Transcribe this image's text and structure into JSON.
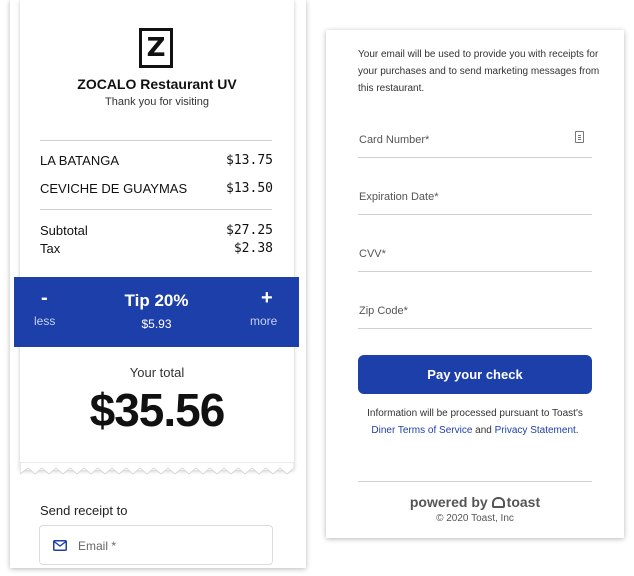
{
  "receipt": {
    "logo_letter": "Z",
    "restaurant_name": "ZOCALO Restaurant UV",
    "subtitle": "Thank you for visiting",
    "items": [
      {
        "name": "LA BATANGA",
        "price": "$13.75"
      },
      {
        "name": "CEVICHE DE GUAYMAS",
        "price": "$13.50"
      }
    ],
    "subtotal_label": "Subtotal",
    "subtotal_value": "$27.25",
    "tax_label": "Tax",
    "tax_value": "$2.38"
  },
  "tip": {
    "minus_symbol": "-",
    "less_label": "less",
    "title": "Tip 20%",
    "amount": "$5.93",
    "plus_symbol": "+",
    "more_label": "more"
  },
  "total": {
    "label": "Your total",
    "amount": "$35.56"
  },
  "send_receipt": {
    "label": "Send receipt to",
    "email_placeholder": "Email *"
  },
  "payment": {
    "email_note": "Your email will be used to provide you with receipts for your purchases and to send marketing messages from this restaurant.",
    "card_number_label": "Card Number*",
    "expiration_label": "Expiration Date*",
    "cvv_label": "CVV*",
    "zip_label": "Zip Code*",
    "pay_button_label": "Pay your check",
    "legal_prefix": "Information will be processed pursuant to Toast's",
    "legal_link_terms": "Diner Terms of Service",
    "legal_and": "and",
    "legal_link_privacy": "Privacy Statement",
    "legal_suffix": ".",
    "powered_by": "powered by",
    "brand": "toast",
    "copyright": "© 2020 Toast, Inc"
  },
  "colors": {
    "accent": "#1c3faa",
    "text": "#111111"
  },
  "icons": {
    "email": "envelope-icon",
    "card": "card-icon",
    "brand": "toast-logo-icon"
  }
}
